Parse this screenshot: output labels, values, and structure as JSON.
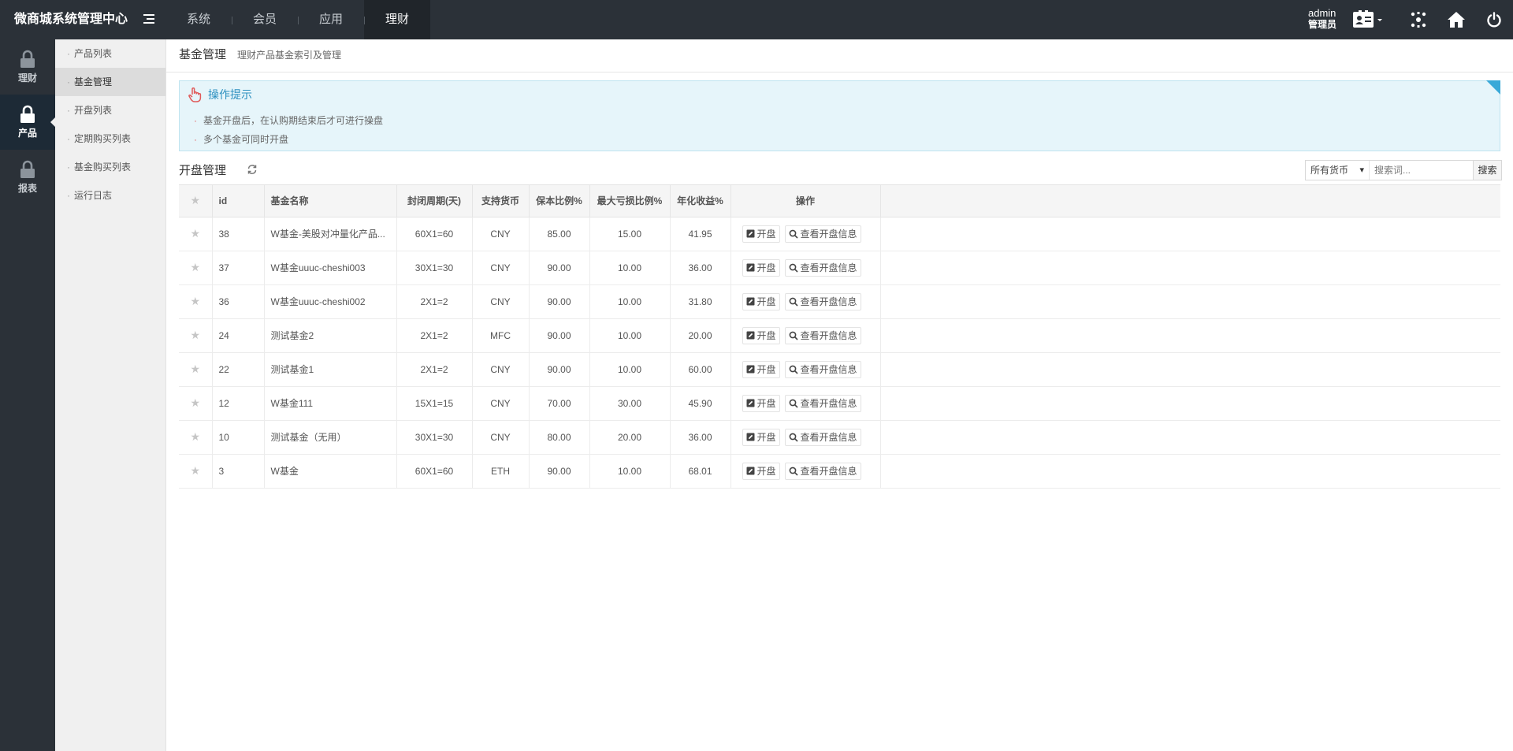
{
  "header": {
    "brand": "微商城系统管理中心",
    "nav": [
      "系统",
      "会员",
      "应用",
      "理财"
    ],
    "active_nav": "理财",
    "user_name": "admin",
    "user_role": "管理员"
  },
  "rail": [
    {
      "label": "理财",
      "icon": "lock-icon"
    },
    {
      "label": "产品",
      "icon": "lock-icon",
      "active": true
    },
    {
      "label": "报表",
      "icon": "lock-icon"
    }
  ],
  "submenu": [
    "产品列表",
    "基金管理",
    "开盘列表",
    "定期购买列表",
    "基金购买列表",
    "运行日志"
  ],
  "submenu_active": "基金管理",
  "page": {
    "title": "基金管理",
    "subtitle": "理财产品基金索引及管理"
  },
  "tips": {
    "title": "操作提示",
    "items": [
      "基金开盘后，在认购期结束后才可进行操盘",
      "多个基金可同时开盘"
    ]
  },
  "section": {
    "title": "开盘管理"
  },
  "search": {
    "select_value": "所有货币",
    "placeholder": "搜索词...",
    "button": "搜索"
  },
  "table": {
    "columns": [
      "id",
      "基金名称",
      "封闭周期(天)",
      "支持货币",
      "保本比例%",
      "最大亏损比例%",
      "年化收益%",
      "操作"
    ],
    "action_open": "开盘",
    "action_view": "查看开盘信息",
    "rows": [
      {
        "id": "38",
        "name": "W基金-美股对冲量化产品...",
        "period": "60X1=60",
        "currency": "CNY",
        "principal": "85.00",
        "max_loss": "15.00",
        "annual": "41.95"
      },
      {
        "id": "37",
        "name": "W基金uuuc-cheshi003",
        "period": "30X1=30",
        "currency": "CNY",
        "principal": "90.00",
        "max_loss": "10.00",
        "annual": "36.00"
      },
      {
        "id": "36",
        "name": "W基金uuuc-cheshi002",
        "period": "2X1=2",
        "currency": "CNY",
        "principal": "90.00",
        "max_loss": "10.00",
        "annual": "31.80"
      },
      {
        "id": "24",
        "name": "测试基金2",
        "period": "2X1=2",
        "currency": "MFC",
        "principal": "90.00",
        "max_loss": "10.00",
        "annual": "20.00"
      },
      {
        "id": "22",
        "name": "测试基金1",
        "period": "2X1=2",
        "currency": "CNY",
        "principal": "90.00",
        "max_loss": "10.00",
        "annual": "60.00"
      },
      {
        "id": "12",
        "name": "W基金111",
        "period": "15X1=15",
        "currency": "CNY",
        "principal": "70.00",
        "max_loss": "30.00",
        "annual": "45.90"
      },
      {
        "id": "10",
        "name": "测试基金（无用）",
        "period": "30X1=30",
        "currency": "CNY",
        "principal": "80.00",
        "max_loss": "20.00",
        "annual": "36.00"
      },
      {
        "id": "3",
        "name": "W基金",
        "period": "60X1=60",
        "currency": "ETH",
        "principal": "90.00",
        "max_loss": "10.00",
        "annual": "68.01"
      }
    ]
  }
}
